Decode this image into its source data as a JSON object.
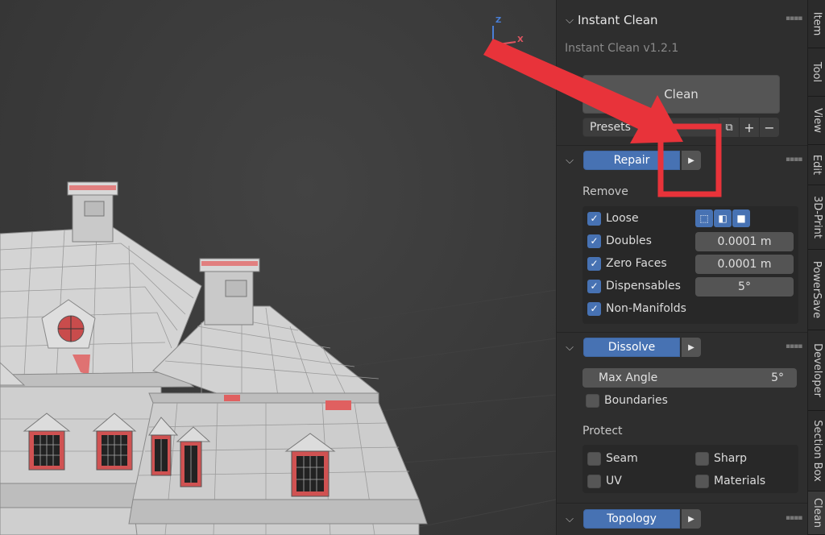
{
  "viewport": {
    "gizmo": {
      "z_label": "Z",
      "x_label": "X",
      "z_color": "#4a7fd6",
      "x_color": "#e05561"
    }
  },
  "panel": {
    "title": "Instant Clean",
    "version": "Instant Clean v1.2.1",
    "clean_label": "Clean",
    "presets_label": "Presets",
    "repair": {
      "label": "Repair",
      "remove_heading": "Remove",
      "items": [
        {
          "label": "Loose",
          "checked": true
        },
        {
          "label": "Doubles",
          "checked": true,
          "value": "0.0001 m"
        },
        {
          "label": "Zero Faces",
          "checked": true,
          "value": "0.0001 m"
        },
        {
          "label": "Dispensables",
          "checked": true,
          "value": "5°"
        },
        {
          "label": "Non-Manifolds",
          "checked": true
        }
      ]
    },
    "dissolve": {
      "label": "Dissolve",
      "max_angle_label": "Max Angle",
      "max_angle_value": "5°",
      "boundaries_label": "Boundaries",
      "protect_heading": "Protect",
      "protect_items": [
        {
          "label": "Seam"
        },
        {
          "label": "Sharp"
        },
        {
          "label": "UV"
        },
        {
          "label": "Materials"
        }
      ]
    },
    "topology": {
      "label": "Topology"
    }
  },
  "tabs": [
    "Item",
    "Tool",
    "View",
    "Edit",
    "3D-Print",
    "PowerSave",
    "Developer",
    "Section Box",
    "Clean"
  ],
  "colors": {
    "accent": "#4772b3",
    "annotation": "#e8333a",
    "panel_bg": "#2e2e2e"
  }
}
